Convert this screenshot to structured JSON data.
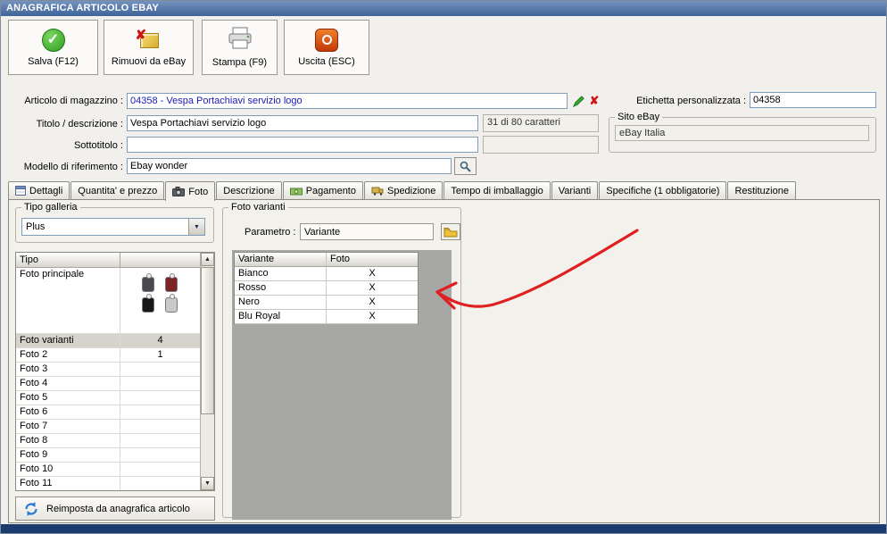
{
  "window": {
    "title": "ANAGRAFICA ARTICOLO EBAY"
  },
  "toolbar": {
    "salva": "Salva (F12)",
    "rimuovi": "Rimuovi da eBay",
    "stampa": "Stampa (F9)",
    "uscita": "Uscita (ESC)"
  },
  "form": {
    "articolo_label": "Articolo di magazzino :",
    "articolo_value": "04358 - Vespa Portachiavi servizio logo",
    "etichetta_label": "Etichetta personalizzata :",
    "etichetta_value": "04358",
    "titolo_label": "Titolo / descrizione :",
    "titolo_value": "Vespa Portachiavi servizio logo",
    "caratteri_counter": "31 di 80 caratteri",
    "sito_label": "Sito eBay",
    "sito_value": "eBay Italia",
    "sottotitolo_label": "Sottotitolo :",
    "sottotitolo_value": "",
    "modello_label": "Modello di riferimento :",
    "modello_value": "Ebay wonder"
  },
  "tabs": [
    {
      "label": "Dettagli"
    },
    {
      "label": "Quantita' e prezzo"
    },
    {
      "label": "Foto"
    },
    {
      "label": "Descrizione"
    },
    {
      "label": "Pagamento"
    },
    {
      "label": "Spedizione"
    },
    {
      "label": "Tempo di imballaggio"
    },
    {
      "label": "Varianti"
    },
    {
      "label": "Specifiche (1 obbligatorie)"
    },
    {
      "label": "Restituzione"
    }
  ],
  "gallery": {
    "group_label": "Tipo galleria",
    "selected": "Plus"
  },
  "foto_table": {
    "header": "Tipo",
    "rows": [
      {
        "label": "Foto principale",
        "value": ""
      },
      {
        "label": "Foto varianti",
        "value": "4"
      },
      {
        "label": "Foto 2",
        "value": "1"
      },
      {
        "label": "Foto 3",
        "value": ""
      },
      {
        "label": "Foto 4",
        "value": ""
      },
      {
        "label": "Foto 5",
        "value": ""
      },
      {
        "label": "Foto 6",
        "value": ""
      },
      {
        "label": "Foto 7",
        "value": ""
      },
      {
        "label": "Foto 8",
        "value": ""
      },
      {
        "label": "Foto 9",
        "value": ""
      },
      {
        "label": "Foto 10",
        "value": ""
      },
      {
        "label": "Foto 11",
        "value": ""
      }
    ]
  },
  "reimposta_label": "Reimposta da anagrafica articolo",
  "varianti": {
    "group_label": "Foto varianti",
    "parametro_label": "Parametro :",
    "parametro_value": "Variante",
    "col_variante": "Variante",
    "col_foto": "Foto",
    "rows": [
      {
        "name": "Bianco",
        "foto": "X"
      },
      {
        "name": "Rosso",
        "foto": "X"
      },
      {
        "name": "Nero",
        "foto": "X"
      },
      {
        "name": "Blu Royal",
        "foto": "X"
      }
    ]
  },
  "colors": {
    "titlebar_blue": "#3f6399",
    "statusbar_blue": "#1c3c70",
    "annotation_red": "#e02020",
    "article_link_blue": "#1a1ab8"
  }
}
